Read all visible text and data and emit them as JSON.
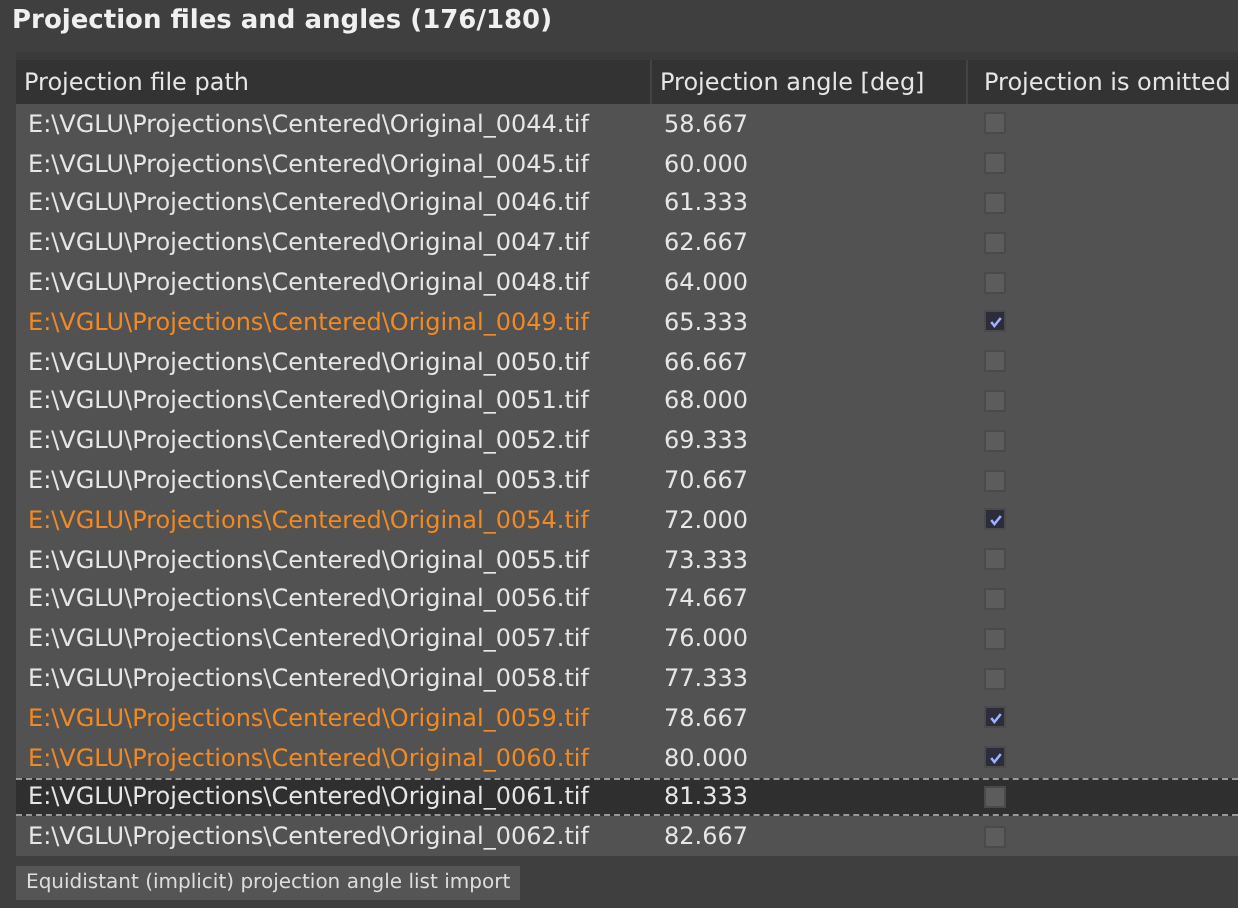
{
  "title": "Projection files and angles (176/180)",
  "table": {
    "columns": [
      "Projection file path",
      "Projection angle [deg]",
      "Projection is omitted"
    ],
    "rows": [
      {
        "path": "E:\\VGLU\\Projections\\Centered\\Original_0044.tif",
        "angle": "58.667",
        "omitted": false,
        "selected": false
      },
      {
        "path": "E:\\VGLU\\Projections\\Centered\\Original_0045.tif",
        "angle": "60.000",
        "omitted": false,
        "selected": false
      },
      {
        "path": "E:\\VGLU\\Projections\\Centered\\Original_0046.tif",
        "angle": "61.333",
        "omitted": false,
        "selected": false
      },
      {
        "path": "E:\\VGLU\\Projections\\Centered\\Original_0047.tif",
        "angle": "62.667",
        "omitted": false,
        "selected": false
      },
      {
        "path": "E:\\VGLU\\Projections\\Centered\\Original_0048.tif",
        "angle": "64.000",
        "omitted": false,
        "selected": false
      },
      {
        "path": "E:\\VGLU\\Projections\\Centered\\Original_0049.tif",
        "angle": "65.333",
        "omitted": true,
        "selected": false
      },
      {
        "path": "E:\\VGLU\\Projections\\Centered\\Original_0050.tif",
        "angle": "66.667",
        "omitted": false,
        "selected": false
      },
      {
        "path": "E:\\VGLU\\Projections\\Centered\\Original_0051.tif",
        "angle": "68.000",
        "omitted": false,
        "selected": false
      },
      {
        "path": "E:\\VGLU\\Projections\\Centered\\Original_0052.tif",
        "angle": "69.333",
        "omitted": false,
        "selected": false
      },
      {
        "path": "E:\\VGLU\\Projections\\Centered\\Original_0053.tif",
        "angle": "70.667",
        "omitted": false,
        "selected": false
      },
      {
        "path": "E:\\VGLU\\Projections\\Centered\\Original_0054.tif",
        "angle": "72.000",
        "omitted": true,
        "selected": false
      },
      {
        "path": "E:\\VGLU\\Projections\\Centered\\Original_0055.tif",
        "angle": "73.333",
        "omitted": false,
        "selected": false
      },
      {
        "path": "E:\\VGLU\\Projections\\Centered\\Original_0056.tif",
        "angle": "74.667",
        "omitted": false,
        "selected": false
      },
      {
        "path": "E:\\VGLU\\Projections\\Centered\\Original_0057.tif",
        "angle": "76.000",
        "omitted": false,
        "selected": false
      },
      {
        "path": "E:\\VGLU\\Projections\\Centered\\Original_0058.tif",
        "angle": "77.333",
        "omitted": false,
        "selected": false
      },
      {
        "path": "E:\\VGLU\\Projections\\Centered\\Original_0059.tif",
        "angle": "78.667",
        "omitted": true,
        "selected": false
      },
      {
        "path": "E:\\VGLU\\Projections\\Centered\\Original_0060.tif",
        "angle": "80.000",
        "omitted": true,
        "selected": false
      },
      {
        "path": "E:\\VGLU\\Projections\\Centered\\Original_0061.tif",
        "angle": "81.333",
        "omitted": false,
        "selected": true
      },
      {
        "path": "E:\\VGLU\\Projections\\Centered\\Original_0062.tif",
        "angle": "82.667",
        "omitted": false,
        "selected": false
      }
    ]
  },
  "button": "Equidistant (implicit) projection angle list import"
}
